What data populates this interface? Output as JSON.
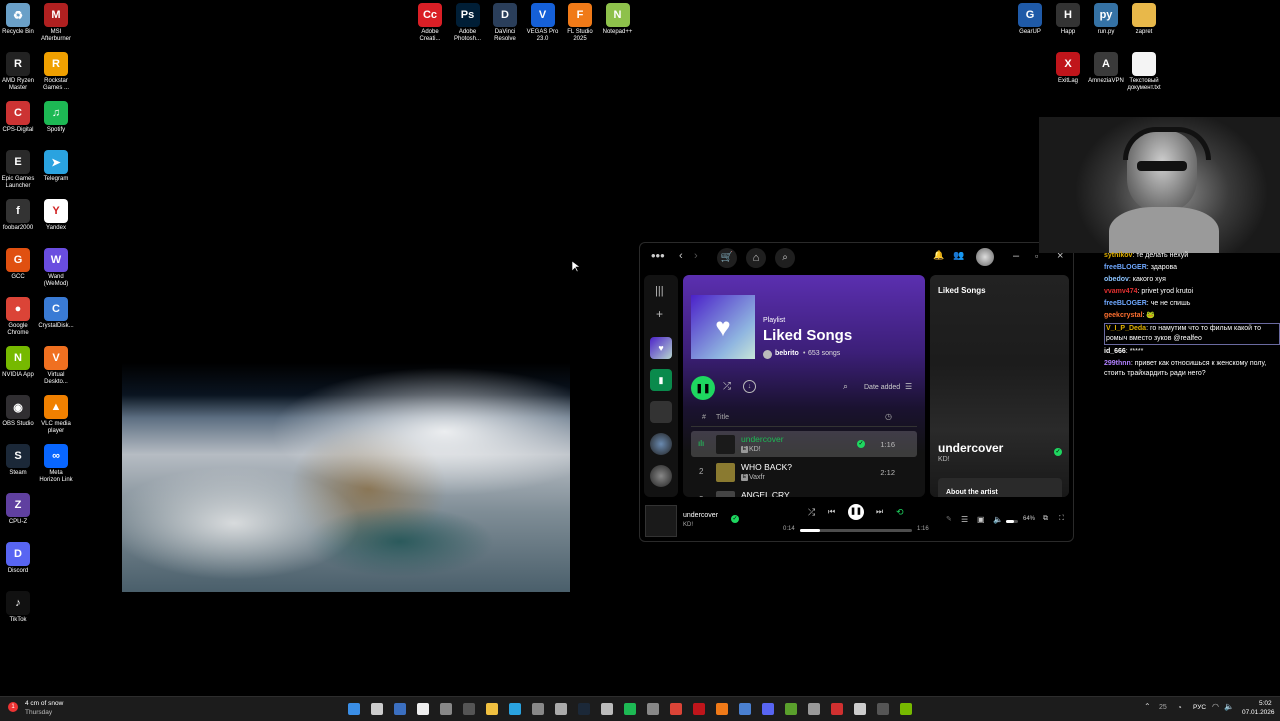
{
  "desktop": {
    "icons_left": [
      {
        "label": "Recycle Bin",
        "icon": "recycle-bin-icon",
        "color": "#6aa0c8",
        "glyph": "♻"
      },
      {
        "label": "MSI\nAfterburner",
        "icon": "msi-afterburner-icon",
        "color": "#b02020",
        "glyph": "M"
      },
      {
        "label": "AMD Ryzen\nMaster",
        "icon": "amd-ryzen-icon",
        "color": "#222222",
        "glyph": "R"
      },
      {
        "label": "Rockstar\nGames ...",
        "icon": "rockstar-icon",
        "color": "#f0a000",
        "glyph": "R"
      },
      {
        "label": "CPS-Digital",
        "icon": "cps-digital-icon",
        "color": "#cc3333",
        "glyph": "C"
      },
      {
        "label": "Spotify",
        "icon": "spotify-icon",
        "color": "#1db954",
        "glyph": "♫"
      },
      {
        "label": "Epic Games\nLauncher",
        "icon": "epic-games-icon",
        "color": "#2a2a2a",
        "glyph": "E"
      },
      {
        "label": "Telegram",
        "icon": "telegram-icon",
        "color": "#2aa3e0",
        "glyph": "➤"
      },
      {
        "label": "foobar2000",
        "icon": "foobar-icon",
        "color": "#333333",
        "glyph": "f"
      },
      {
        "label": "Yandex",
        "icon": "yandex-icon",
        "color": "#ffffff",
        "glyph": "Y"
      },
      {
        "label": "GCC",
        "icon": "gcc-icon",
        "color": "#e05010",
        "glyph": "G"
      },
      {
        "label": "Wand\n(WeMod)",
        "icon": "wand-icon",
        "color": "#6a4de0",
        "glyph": "W"
      },
      {
        "label": "Google\nChrome",
        "icon": "chrome-icon",
        "color": "#db4437",
        "glyph": "●"
      },
      {
        "label": "CrystalDisk...",
        "icon": "crystaldisk-icon",
        "color": "#3a7bd5",
        "glyph": "C"
      },
      {
        "label": "NVIDIA App",
        "icon": "nvidia-icon",
        "color": "#76b900",
        "glyph": "N"
      },
      {
        "label": "Virtual\nDeskto...",
        "icon": "virtual-desktop-icon",
        "color": "#f07020",
        "glyph": "V"
      },
      {
        "label": "OBS Studio",
        "icon": "obs-icon",
        "color": "#302e31",
        "glyph": "◉"
      },
      {
        "label": "VLC media\nplayer",
        "icon": "vlc-icon",
        "color": "#f08000",
        "glyph": "▲"
      },
      {
        "label": "Steam",
        "icon": "steam-icon",
        "color": "#1b2838",
        "glyph": "S"
      },
      {
        "label": "Meta\nHorizon Link",
        "icon": "meta-icon",
        "color": "#0866ff",
        "glyph": "∞"
      },
      {
        "label": "CPU-Z",
        "icon": "cpuz-icon",
        "color": "#6040a0",
        "glyph": "Z"
      },
      {
        "label": "Discord",
        "icon": "discord-icon",
        "color": "#5865f2",
        "glyph": "D"
      },
      {
        "label": "TikTok",
        "icon": "tiktok-icon",
        "color": "#111111",
        "glyph": "♪"
      }
    ],
    "icons_top": [
      {
        "label": "Adobe\nCreati...",
        "icon": "adobe-cc-icon",
        "color": "#da1f26",
        "glyph": "Cc"
      },
      {
        "label": "Adobe\nPhotosh...",
        "icon": "photoshop-icon",
        "color": "#001e36",
        "glyph": "Ps"
      },
      {
        "label": "DaVinci\nResolve",
        "icon": "davinci-icon",
        "color": "#2a3e5a",
        "glyph": "D"
      },
      {
        "label": "VEGAS Pro\n23.0",
        "icon": "vegas-icon",
        "color": "#1560d8",
        "glyph": "V"
      },
      {
        "label": "FL Studio\n2025",
        "icon": "fl-studio-icon",
        "color": "#f07a18",
        "glyph": "F"
      },
      {
        "label": "Notepad++",
        "icon": "notepadpp-icon",
        "color": "#8ec14b",
        "glyph": "N"
      }
    ],
    "icons_right": [
      {
        "label": "GearUP",
        "icon": "gearup-icon",
        "color": "#1f5aa8",
        "glyph": "G"
      },
      {
        "label": "Happ",
        "icon": "happ-icon",
        "color": "#333333",
        "glyph": "H"
      },
      {
        "label": "run.py",
        "icon": "python-file-icon",
        "color": "#3572a5",
        "glyph": "py"
      },
      {
        "label": "zapret",
        "icon": "folder-icon",
        "color": "#e8b84a",
        "glyph": ""
      },
      {
        "label": "ExitLag",
        "icon": "exitlag-icon",
        "color": "#c0151b",
        "glyph": "X"
      },
      {
        "label": "AmneziaVPN",
        "icon": "amnezia-icon",
        "color": "#3a3a3a",
        "glyph": "A"
      },
      {
        "label": "Текстовый\nдокумент.txt",
        "icon": "text-file-icon",
        "color": "#f4f4f4",
        "glyph": ""
      }
    ]
  },
  "spotify": {
    "playlist_type": "Playlist",
    "playlist_title": "Liked Songs",
    "owner": "bebrito",
    "song_count": "653 songs",
    "sort_label": "Date added",
    "col_hash": "#",
    "col_title": "Title",
    "tracks": [
      {
        "num": "",
        "title": "undercover",
        "artist": "KD!",
        "duration": "1:16",
        "playing": true,
        "color": "#1db954",
        "thumb": "#1a1a1a"
      },
      {
        "num": "2",
        "title": "WHO BACK?",
        "artist": "Vaxfr",
        "duration": "2:12",
        "playing": false,
        "color": "#ffffff",
        "thumb": "#8a7a30"
      },
      {
        "num": "3",
        "title": "ANGEL CRY",
        "artist": "",
        "duration": "",
        "playing": false,
        "color": "#ffffff",
        "thumb": "#444444"
      }
    ],
    "right_panel": {
      "title": "Liked Songs",
      "track": "undercover",
      "artist": "KD!",
      "about": "About the artist"
    },
    "player": {
      "track": "undercover",
      "artist": "KD!",
      "elapsed": "0:14",
      "total": "1:16",
      "volume": "64%",
      "progress": 0.18,
      "volume_level": 0.64
    }
  },
  "chat": [
    {
      "user": "sytnikov",
      "color": "#e0b000",
      "text": "те делать нехуй"
    },
    {
      "user": "freeBLOGER",
      "color": "#6fa8ff",
      "text": "здарова"
    },
    {
      "user": "obedov",
      "color": "#8bc3ff",
      "text": "какого хуя"
    },
    {
      "user": "vvamv474",
      "color": "#e03030",
      "text": "privet yrod krutoi"
    },
    {
      "user": "freeBLOGER",
      "color": "#6fa8ff",
      "text": "че не спишь"
    },
    {
      "user": "geekcrystal",
      "color": "#ff7030",
      "text": "🐸"
    },
    {
      "user": "V_I_P_Deda",
      "color": "#e0b000",
      "text": "го намутим что то фильм какой то ромыч вместо зуков @realfeo"
    },
    {
      "user": "id_666",
      "color": "#ffffff",
      "text": "*****"
    },
    {
      "user": "299thnn",
      "color": "#b080ff",
      "text": "привет как относишься к женскому полу, стоить трайхардить ради него?"
    }
  ],
  "taskbar": {
    "weather_line1": "4 cm of snow",
    "weather_line2": "Thursday",
    "lang": "РУС",
    "time": "5:02",
    "date": "07.01.2026",
    "number": "25"
  }
}
